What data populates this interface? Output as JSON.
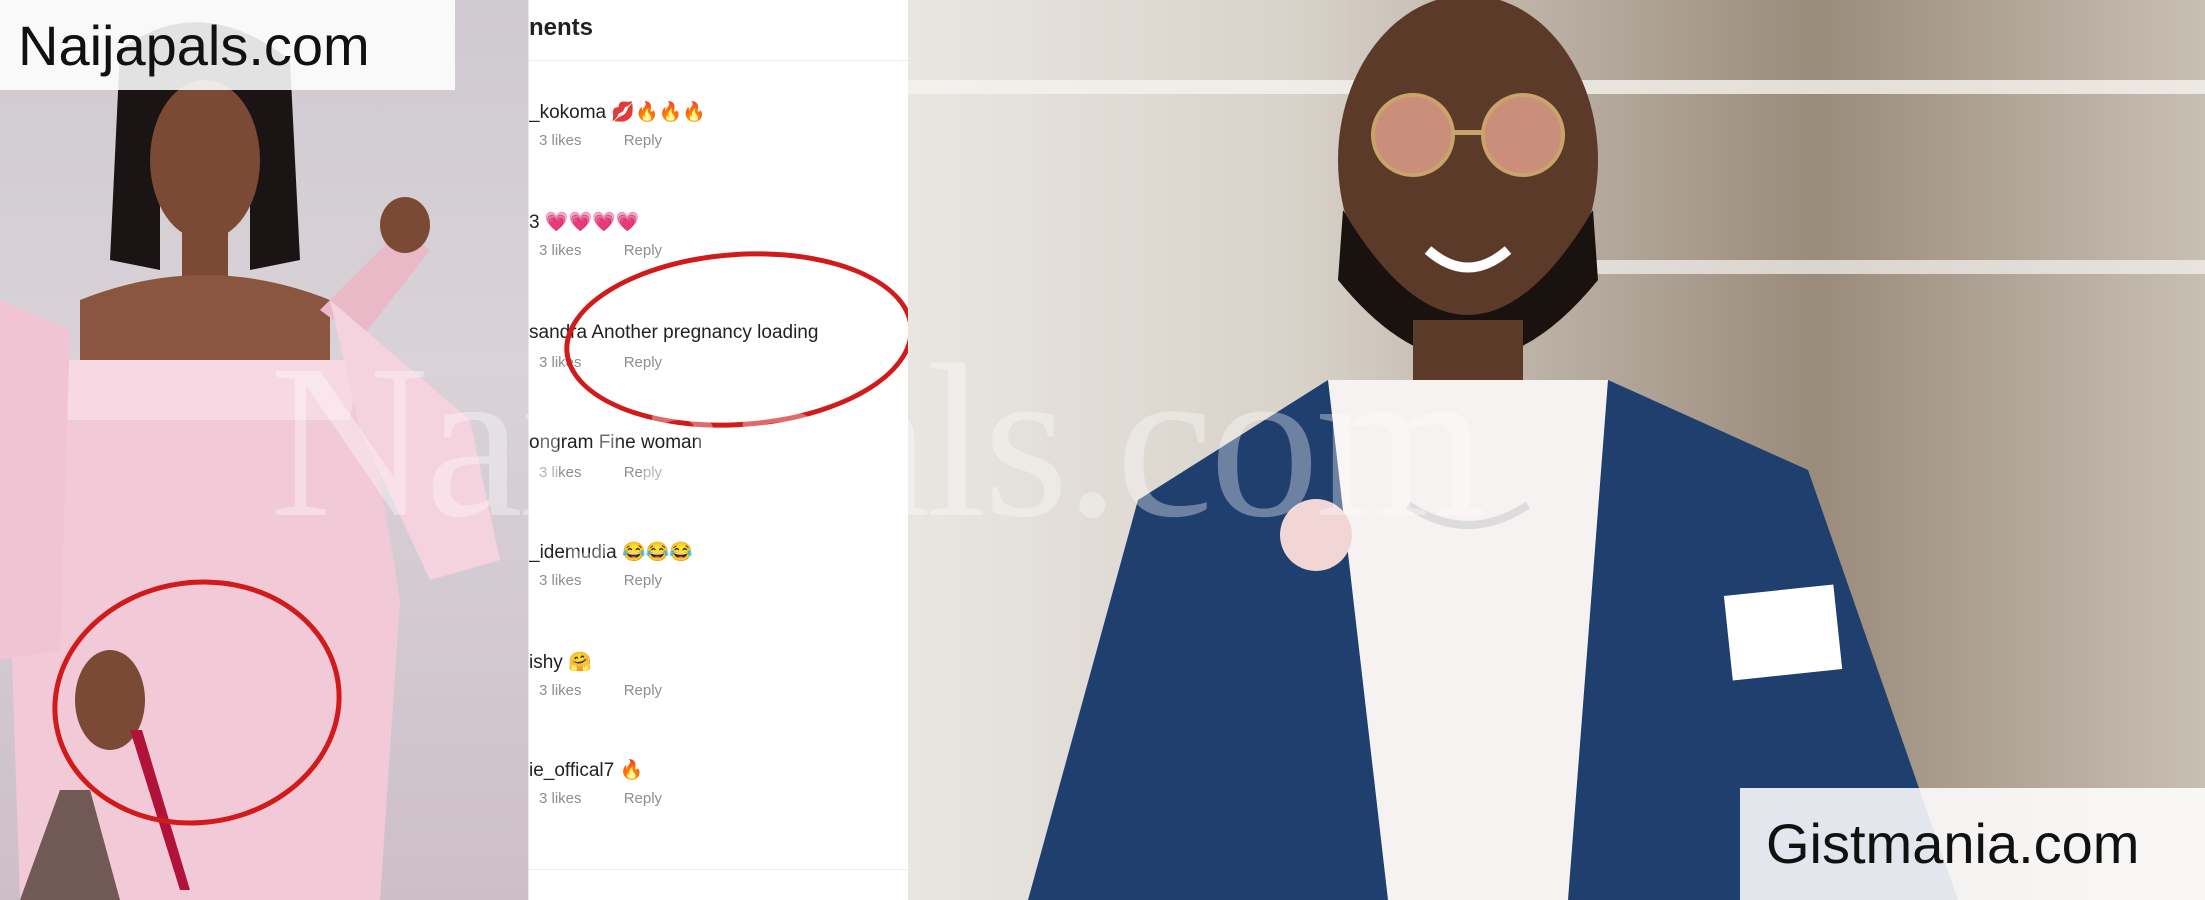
{
  "corner_labels": {
    "top_left": "Naijapals.com",
    "bottom_right": "Gistmania.com"
  },
  "watermark": "Naijapals.com",
  "comments_panel": {
    "header": "nents",
    "items": [
      {
        "user_text": "_kokoma",
        "emoji": "💋🔥🔥🔥",
        "likes": "3 likes",
        "reply": "Reply"
      },
      {
        "user_text": "3",
        "emoji": "💗💗💗💗",
        "likes": "3 likes",
        "reply": "Reply"
      },
      {
        "user_text": "sandra Another pregnancy loading",
        "emoji": "",
        "likes": "3 likes",
        "reply": "Reply"
      },
      {
        "user_text": "ongram Fine woman",
        "emoji": "",
        "likes": "3 likes",
        "reply": "Reply"
      },
      {
        "user_text": "_idemudia",
        "emoji": "😂😂😂",
        "likes": "3 likes",
        "reply": "Reply"
      },
      {
        "user_text": "ishy",
        "emoji": "🤗",
        "likes": "3 likes",
        "reply": "Reply"
      },
      {
        "user_text": "ie_offical7",
        "emoji": "🔥",
        "likes": "3 likes",
        "reply": "Reply"
      }
    ]
  },
  "colors": {
    "annotation_red": "#d11a1a",
    "dress_pink": "#f2c9d6",
    "suit_blue": "#1f3f6e"
  }
}
